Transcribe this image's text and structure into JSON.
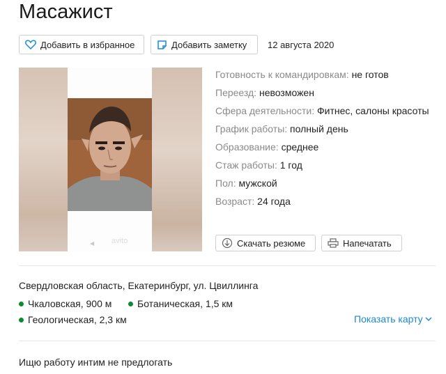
{
  "header": {
    "title": "Масажист"
  },
  "actions": {
    "favorite_label": "Добавить в избранное",
    "note_label": "Добавить заметку",
    "date": "12 августа 2020"
  },
  "photo": {
    "watermark": "avito"
  },
  "details": [
    {
      "label": "Готовность к командировкам:",
      "value": "не готов"
    },
    {
      "label": "Переезд:",
      "value": "невозможен"
    },
    {
      "label": "Сфера деятельности:",
      "value": "Фитнес, салоны красоты"
    },
    {
      "label": "График работы:",
      "value": "полный день"
    },
    {
      "label": "Образование:",
      "value": "среднее"
    },
    {
      "label": "Стаж работы:",
      "value": "1 год"
    },
    {
      "label": "Пол:",
      "value": "мужской"
    },
    {
      "label": "Возраст:",
      "value": "24 года"
    }
  ],
  "doc_actions": {
    "download_label": "Скачать резюме",
    "print_label": "Напечатать"
  },
  "location": {
    "address": "Свердловская область, Екатеринбург, ул. Цвиллинга",
    "metro": [
      {
        "name": "Чкаловская, 900 м"
      },
      {
        "name": "Ботаническая, 1,5 км"
      },
      {
        "name": "Геологическая, 2,3 км"
      }
    ],
    "metro_color": "#0c8a37",
    "map_link": "Показать карту"
  },
  "description": "Ищю работу интим не предлогать",
  "colors": {
    "link": "#1a8ad4",
    "label": "#8a8a8a"
  }
}
